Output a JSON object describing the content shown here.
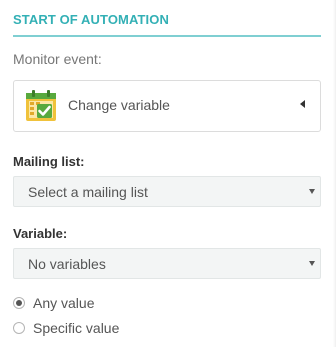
{
  "section": {
    "title": "START OF AUTOMATION"
  },
  "monitor": {
    "label": "Monitor event:",
    "event": "Change variable",
    "icon": "calendar-check-icon"
  },
  "mailing_list": {
    "label": "Mailing list:",
    "value": "Select a mailing list"
  },
  "variable": {
    "label": "Variable:",
    "value": "No variables"
  },
  "value_options": [
    {
      "label": "Any value",
      "selected": true
    },
    {
      "label": "Specific value",
      "selected": false
    }
  ],
  "colors": {
    "accent": "#33b0b5",
    "icon_green": "#58a93e",
    "icon_yellow": "#f0c23b"
  }
}
